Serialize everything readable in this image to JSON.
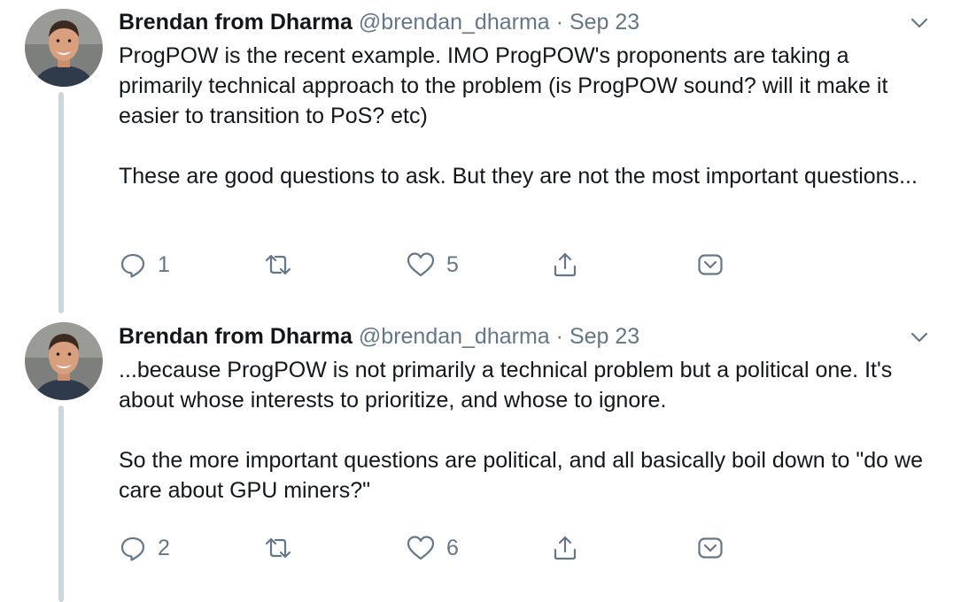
{
  "colors": {
    "text": "#14171a",
    "secondary": "#657786",
    "thread_line": "#ccd6dd"
  },
  "tweets": [
    {
      "author_name": "Brendan from Dharma",
      "handle": "@brendan_dharma",
      "separator": "·",
      "date": "Sep 23",
      "paragraphs": [
        "ProgPOW is the recent example. IMO ProgPOW's proponents are taking a primarily technical approach to the problem (is ProgPOW sound? will it make it easier to transition to PoS? etc)",
        "These are good questions to ask. But they are not the most important questions..."
      ],
      "reply_count": "1",
      "like_count": "5",
      "icons": [
        "reply-icon",
        "retweet-icon",
        "like-icon",
        "share-icon",
        "dm-icon",
        "chevron-down-icon"
      ]
    },
    {
      "author_name": "Brendan from Dharma",
      "handle": "@brendan_dharma",
      "separator": "·",
      "date": "Sep 23",
      "paragraphs": [
        "...because ProgPOW is not primarily a technical problem but a political one. It's about whose interests to prioritize, and whose to ignore.",
        "So the more important questions are political, and all basically boil down to \"do we care about GPU miners?\""
      ],
      "reply_count": "2",
      "like_count": "6",
      "icons": [
        "reply-icon",
        "retweet-icon",
        "like-icon",
        "share-icon",
        "dm-icon",
        "chevron-down-icon"
      ]
    }
  ]
}
